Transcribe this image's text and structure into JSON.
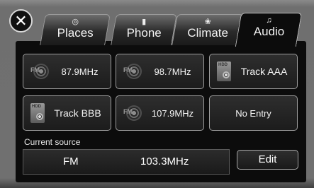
{
  "tabs": [
    {
      "label": "Places",
      "icon": "compass-icon",
      "glyph": "◎"
    },
    {
      "label": "Phone",
      "icon": "phone-icon",
      "glyph": "▮"
    },
    {
      "label": "Climate",
      "icon": "fan-icon",
      "glyph": "❀"
    },
    {
      "label": "Audio",
      "icon": "music-note-icon",
      "glyph": "♫"
    }
  ],
  "active_tab": "Audio",
  "close": {
    "glyph": "✕"
  },
  "presets": [
    {
      "label": "87.9MHz",
      "icon": "fm-radio-icon"
    },
    {
      "label": "98.7MHz",
      "icon": "fm-radio-icon"
    },
    {
      "label": "Track AAA",
      "icon": "hdd-icon"
    },
    {
      "label": "Track BBB",
      "icon": "hdd-icon"
    },
    {
      "label": "107.9MHz",
      "icon": "fm-radio-icon"
    },
    {
      "label": "No Entry",
      "icon": ""
    }
  ],
  "icon_text": {
    "fm": "FM",
    "hdd": "HDD"
  },
  "current_source": {
    "heading": "Current source",
    "band": "FM",
    "frequency": "103.3MHz"
  },
  "edit_label": "Edit"
}
